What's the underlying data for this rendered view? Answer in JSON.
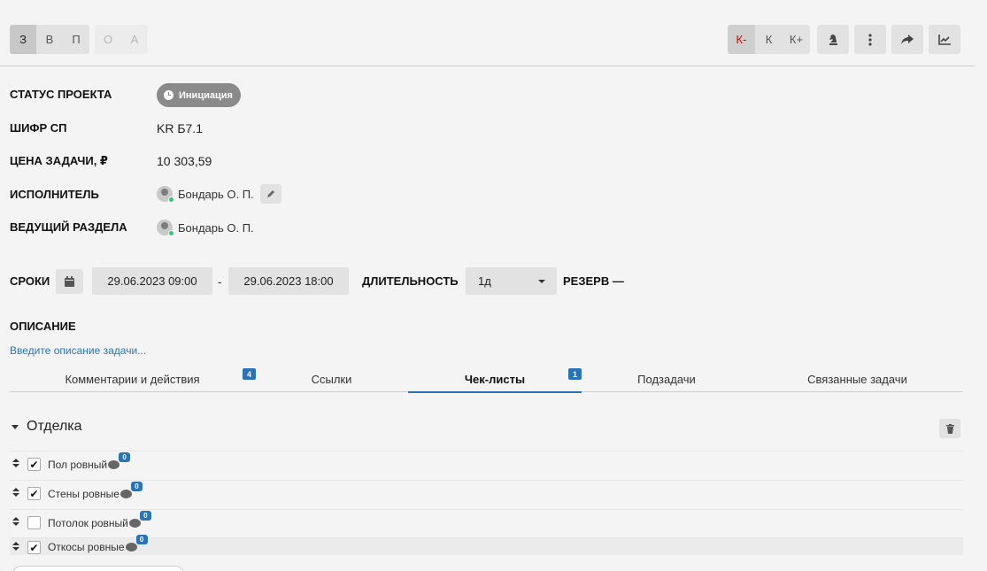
{
  "toolbar": {
    "group1": [
      "З",
      "В",
      "П"
    ],
    "group2": [
      "О",
      "А"
    ],
    "priority": [
      "К-",
      "К",
      "К+"
    ],
    "icons": [
      "chess-knight-icon",
      "more-vertical-icon",
      "share-icon",
      "chart-icon"
    ]
  },
  "fields": {
    "status_label": "СТАТУС ПРОЕКТА",
    "status_value": "Инициация",
    "code_label": "ШИФР СП",
    "code_value": "KR Б7.1",
    "price_label": "ЦЕНА ЗАДАЧИ, ₽",
    "price_value": "10 303,59",
    "assignee_label": "ИСПОЛНИТЕЛЬ",
    "assignee_name": "Бондарь О. П.",
    "lead_label": "ВЕДУЩИЙ РАЗДЕЛА",
    "lead_name": "Бондарь О. П."
  },
  "dates": {
    "label": "СРОКИ",
    "start": "29.06.2023  09:00",
    "separator": "-",
    "end": "29.06.2023  18:00",
    "duration_label": "ДЛИТЕЛЬНОСТЬ",
    "duration_value": "1д",
    "reserve_label": "РЕЗЕРВ —"
  },
  "description": {
    "label": "ОПИСАНИЕ",
    "placeholder": "Введите описание задачи..."
  },
  "tabs": [
    {
      "label": "Комментарии и действия",
      "count": "4"
    },
    {
      "label": "Ссылки"
    },
    {
      "label": "Чек-листы",
      "count": "1",
      "active": true
    },
    {
      "label": "Подзадачи"
    },
    {
      "label": "Связанные задачи"
    }
  ],
  "checklist": {
    "title": "Отделка",
    "items": [
      {
        "label": "Пол ровный",
        "checked": "✔",
        "comments": "0"
      },
      {
        "label": "Стены ровные",
        "checked": "✔",
        "comments": "0"
      },
      {
        "label": "Потолок ровный",
        "checked": "",
        "comments": "0"
      },
      {
        "label": "Откосы ровные",
        "checked": "✔",
        "comments": "0"
      }
    ]
  },
  "colors": {
    "accent": "#2a73b8",
    "status_badge": "#8a8a8a",
    "priority_active": "#dd0000",
    "online": "#2ecc71"
  }
}
